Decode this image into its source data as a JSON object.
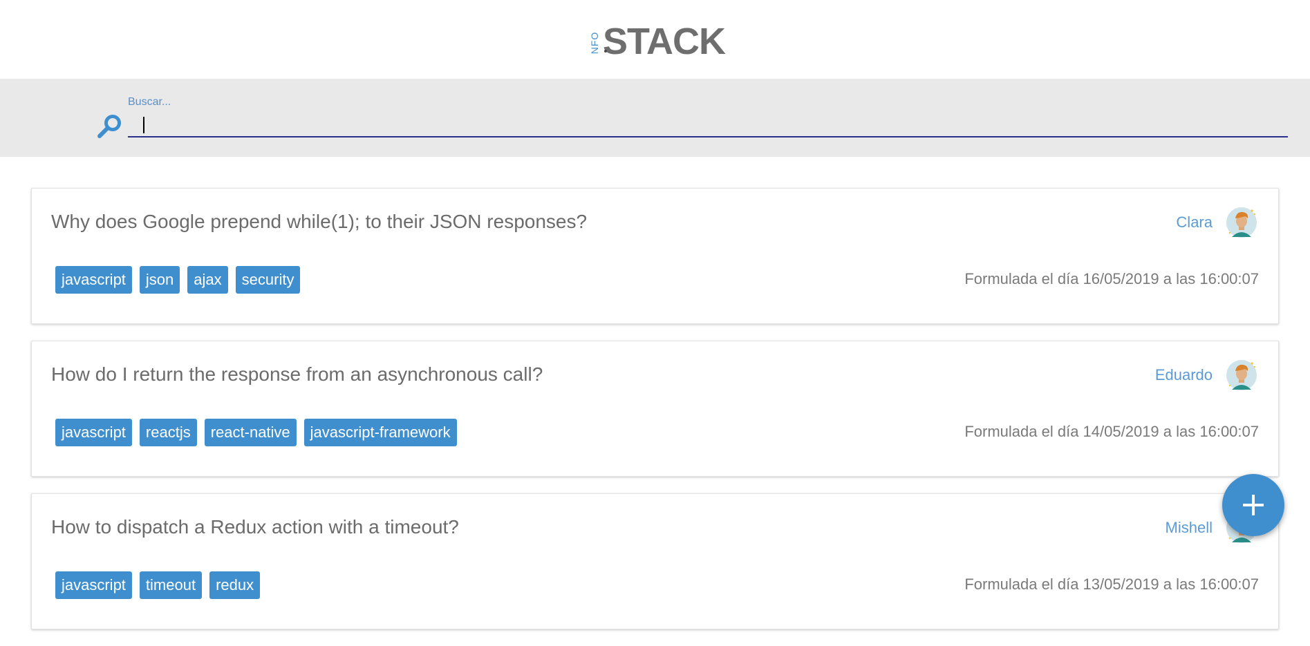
{
  "brand": {
    "prefix": "NFO",
    "name": "STACK",
    "accent_color": "#3f8fcf"
  },
  "search": {
    "label": "Buscar...",
    "value": "",
    "icon": "search-icon"
  },
  "questions": [
    {
      "title": "Why does Google prepend while(1); to their JSON responses?",
      "author": "Clara",
      "tags": [
        "javascript",
        "json",
        "ajax",
        "security"
      ],
      "date": "Formulada el día 16/05/2019 a las 16:00:07"
    },
    {
      "title": "How do I return the response from an asynchronous call?",
      "author": "Eduardo",
      "tags": [
        "javascript",
        "reactjs",
        "react-native",
        "javascript-framework"
      ],
      "date": "Formulada el día 14/05/2019 a las 16:00:07"
    },
    {
      "title": "How to dispatch a Redux action with a timeout?",
      "author": "Mishell",
      "tags": [
        "javascript",
        "timeout",
        "redux"
      ],
      "date": "Formulada el día 13/05/2019 a las 16:00:07"
    }
  ],
  "fab": {
    "icon": "plus-icon"
  }
}
